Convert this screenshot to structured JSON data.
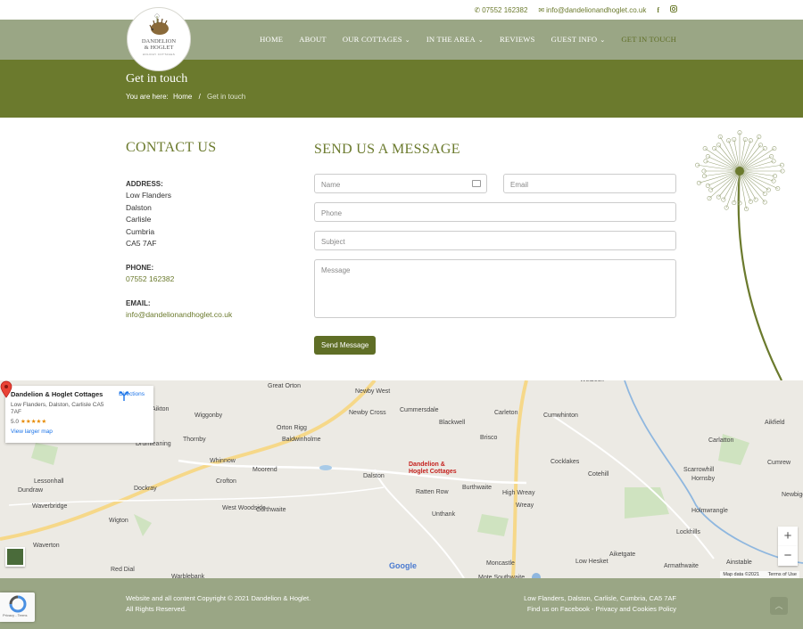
{
  "topbar": {
    "phone": "07552 162382",
    "email": "info@dandelionandhoglet.co.uk",
    "facebook_icon": "facebook-icon",
    "instagram_icon": "instagram-icon"
  },
  "logo": {
    "line1": "DANDELION",
    "line2": "& HOGLET",
    "tagline": "HOLIDAY COTTAGES"
  },
  "nav": {
    "items": [
      {
        "label": "HOME"
      },
      {
        "label": "ABOUT"
      },
      {
        "label": "OUR COTTAGES",
        "dropdown": true
      },
      {
        "label": "IN THE AREA",
        "dropdown": true
      },
      {
        "label": "REVIEWS"
      },
      {
        "label": "GUEST INFO",
        "dropdown": true
      },
      {
        "label": "GET IN TOUCH",
        "active": true
      }
    ]
  },
  "page": {
    "title": "Get in touch",
    "breadcrumb_prefix": "You are here:",
    "breadcrumb_home": "Home",
    "breadcrumb_separator": "/",
    "breadcrumb_current": "Get in touch"
  },
  "contact": {
    "heading": "CONTACT US",
    "address_label": "ADDRESS:",
    "address_lines": [
      "Low Flanders",
      "Dalston",
      "Carlisle",
      "Cumbria",
      "CA5 7AF"
    ],
    "phone_label": "PHONE:",
    "phone": "07552 162382",
    "email_label": "EMAIL:",
    "email": "info@dandelionandhoglet.co.uk"
  },
  "form": {
    "heading": "SEND US A MESSAGE",
    "name_placeholder": "Name",
    "email_placeholder": "Email",
    "phone_placeholder": "Phone",
    "subject_placeholder": "Subject",
    "message_placeholder": "Message",
    "submit_label": "Send Message"
  },
  "map": {
    "place_name": "Dandelion & Hoglet Cottages",
    "place_address": "Low Flanders, Dalston, Carlisle CA5 7AF",
    "rating": "5.0",
    "stars": "★★★★★",
    "larger_map_link": "View larger map",
    "directions_label": "Directions",
    "pin_label_1": "Dandelion &",
    "pin_label_2": "Hoglet Cottages",
    "zoom_in": "+",
    "zoom_out": "−",
    "google_logo": "Google",
    "map_data": "Map data ©2021",
    "terms": "Terms of Use",
    "towns": [
      "Great Orton",
      "Newby West",
      "Welbeck",
      "Wiggonby",
      "Newby Cross",
      "Cummersdale",
      "Carleton",
      "Cumwhinton",
      "Aikton",
      "Orton Rigg",
      "Blackwell",
      "Brisco",
      "Carlatton",
      "Aikfield",
      "Thornby",
      "Baldwinholme",
      "Drumleaning",
      "Whinnow",
      "Moorend",
      "Dalston",
      "Cocklakes",
      "Cotehill",
      "Scarrowhill",
      "Hornsby",
      "Cumrew",
      "Lessonhall",
      "Dockray",
      "Crofton",
      "Ratten Row",
      "Burthwaite",
      "High Wreay",
      "Dundraw",
      "Waverbridge",
      "West Woodside",
      "Curthwaite",
      "Unthank",
      "Wreay",
      "Holmwrangle",
      "Newbiggin",
      "Wigton",
      "Lockhills",
      "Waverton",
      "Aiketgate",
      "Red Dial",
      "Low Hesket",
      "Ainstable",
      "Moncastle",
      "Armathwaite",
      "Warblebank",
      "Mote Southwaite"
    ]
  },
  "footer": {
    "copyright": "Website and all content Copyright © 2021 Dandelion & Hoglet.",
    "rights": "All Rights Reserved.",
    "address": "Low Flanders, Dalston, Carlisle, Cumbria, CA5 7AF",
    "facebook_prefix": "Find us on Facebook",
    "separator": " - ",
    "privacy": "Privacy and Cookies Policy",
    "recaptcha_text": "Privacy - Terms"
  },
  "colors": {
    "olive": "#6b7a2d",
    "sage": "#9aa685",
    "button": "#5f6e26"
  }
}
